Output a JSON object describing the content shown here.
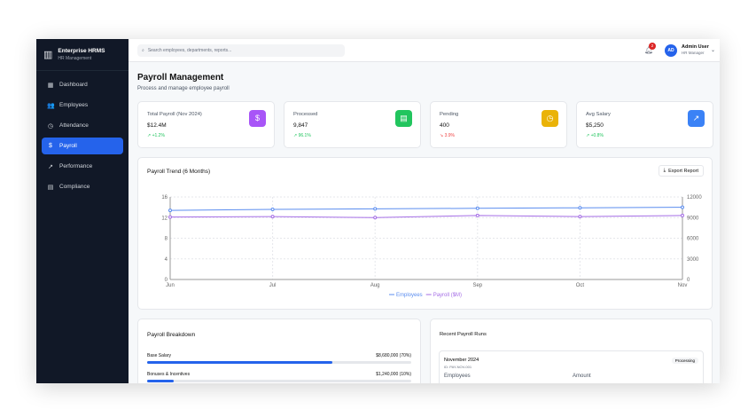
{
  "app": {
    "title": "Enterprise HRMS",
    "subtitle": "HR Management"
  },
  "sidebar": {
    "items": [
      {
        "label": "Dashboard",
        "icon": "grid-icon",
        "glyph": "▦"
      },
      {
        "label": "Employees",
        "icon": "users-icon",
        "glyph": "👥"
      },
      {
        "label": "Attendance",
        "icon": "clock-icon",
        "glyph": "◷"
      },
      {
        "label": "Payroll",
        "icon": "dollar-icon",
        "glyph": "$",
        "active": true
      },
      {
        "label": "Performance",
        "icon": "trending-up-icon",
        "glyph": "↗"
      },
      {
        "label": "Compliance",
        "icon": "document-icon",
        "glyph": "▤"
      }
    ]
  },
  "header": {
    "search_placeholder": "Search employees, departments, reports...",
    "notifications": "2",
    "user": {
      "initials": "AD",
      "name": "Admin User",
      "role": "HR Manager"
    }
  },
  "page": {
    "title": "Payroll Management",
    "subtitle": "Process and manage employee payroll"
  },
  "stats": [
    {
      "label": "Total Payroll (Nov 2024)",
      "value": "$12.4M",
      "change": "+1.2%",
      "trend": "up",
      "color": "#a855f7",
      "glyph": "$",
      "icon": "dollar-icon"
    },
    {
      "label": "Processed",
      "value": "9,847",
      "change": "96.1%",
      "trend": "up",
      "color": "#22c55e",
      "glyph": "▤",
      "icon": "document-icon"
    },
    {
      "label": "Pending",
      "value": "400",
      "change": "3.9%",
      "trend": "down",
      "color": "#eab308",
      "glyph": "◷",
      "icon": "clock-icon"
    },
    {
      "label": "Avg Salary",
      "value": "$5,250",
      "change": "+0.8%",
      "trend": "up",
      "color": "#3b82f6",
      "glyph": "↗",
      "icon": "trending-up-icon"
    }
  ],
  "trend": {
    "title": "Payroll Trend (6 Months)",
    "export_label": "Export Report"
  },
  "chart_data": {
    "type": "line",
    "categories": [
      "Jun",
      "Jul",
      "Aug",
      "Sep",
      "Oct",
      "Nov"
    ],
    "left_axis": {
      "range": [
        0,
        16
      ],
      "ticks": [
        0,
        4,
        8,
        12,
        16
      ]
    },
    "right_axis": {
      "range": [
        0,
        12000
      ],
      "ticks": [
        0,
        3000,
        6000,
        9000,
        12000
      ]
    },
    "grid": true,
    "legend": "bottom",
    "series": [
      {
        "name": "Employees",
        "axis": "right",
        "color": "#5b8def",
        "values": [
          10050,
          10200,
          10275,
          10350,
          10425,
          10500
        ]
      },
      {
        "name": "Payroll ($M)",
        "axis": "left",
        "color": "#a56ee6",
        "values": [
          12.1,
          12.2,
          12.0,
          12.4,
          12.2,
          12.4
        ]
      }
    ]
  },
  "breakdown": {
    "title": "Payroll Breakdown",
    "items": [
      {
        "label": "Base Salary",
        "amount": "$8,680,000 (70%)",
        "pct": 70
      },
      {
        "label": "Bonuses & Incentives",
        "amount": "$1,240,000 (10%)",
        "pct": 10
      }
    ]
  },
  "runs": {
    "title": "Recent Payroll Runs",
    "items": [
      {
        "period": "November 2024",
        "id": "ID: PAY-NOV-001",
        "status": "Processing",
        "col1": "Employees",
        "col2": "Amount"
      }
    ]
  }
}
